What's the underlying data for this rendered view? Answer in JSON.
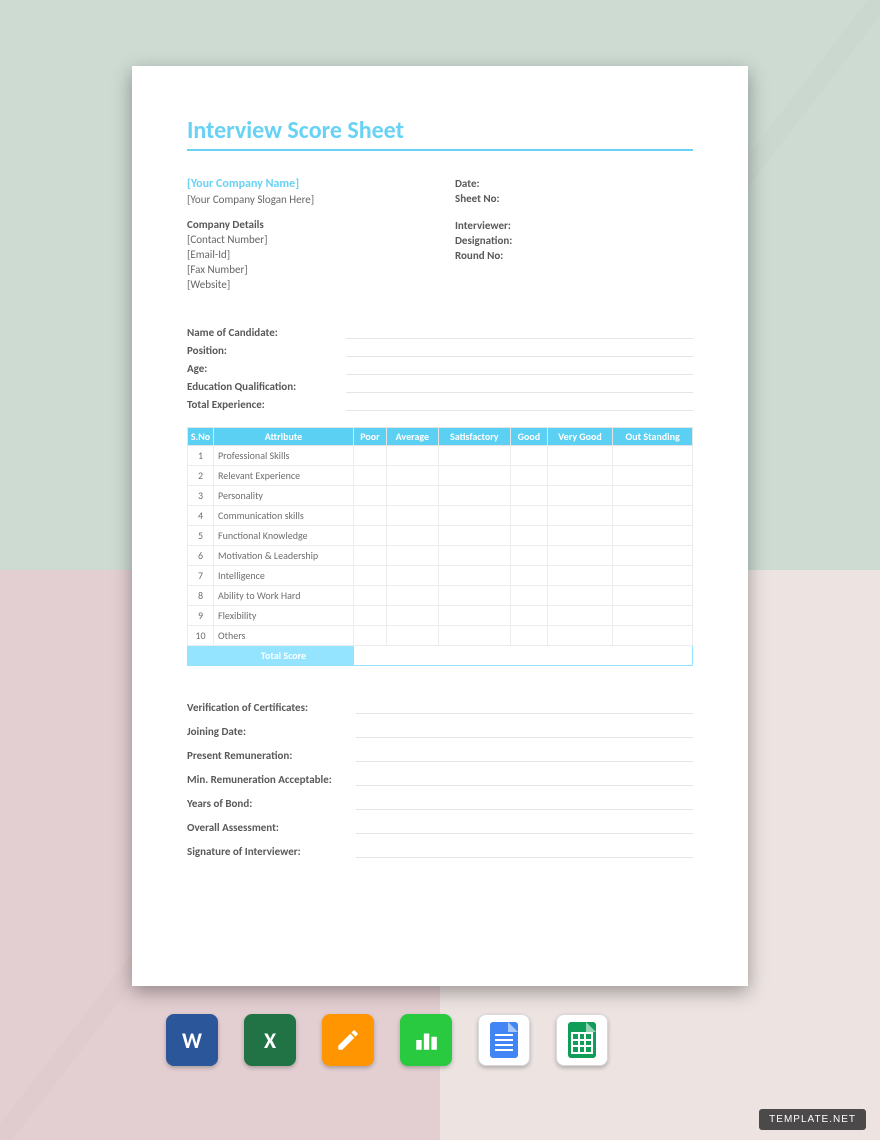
{
  "watermark": "TEMPLATE.NET",
  "document": {
    "title": "Interview Score Sheet",
    "company_name_placeholder": "[Your Company Name]",
    "company_slogan_placeholder": "[Your Company Slogan Here]",
    "meta_right": [
      "Date:",
      "Sheet No:"
    ],
    "company_details_heading": "Company Details",
    "company_details": [
      "[Contact Number]",
      "[Email-Id]",
      "[Fax Number]",
      "[Website]"
    ],
    "interviewer_fields": [
      "Interviewer:",
      "Designation:",
      "Round No:"
    ],
    "candidate_fields": [
      "Name of Candidate:",
      "Position:",
      "Age:",
      "Education Qualification:",
      "Total Experience:"
    ],
    "score_table": {
      "headers": [
        "S.No",
        "Attribute",
        "Poor",
        "Average",
        "Satisfactory",
        "Good",
        "Very Good",
        "Out Standing"
      ],
      "rows": [
        {
          "sn": "1",
          "attr": "Professional Skills"
        },
        {
          "sn": "2",
          "attr": "Relevant Experience"
        },
        {
          "sn": "3",
          "attr": "Personality"
        },
        {
          "sn": "4",
          "attr": "Communication skills"
        },
        {
          "sn": "5",
          "attr": "Functional Knowledge"
        },
        {
          "sn": "6",
          "attr": "Motivation & Leadership"
        },
        {
          "sn": "7",
          "attr": "Intelligence"
        },
        {
          "sn": "8",
          "attr": "Ability to Work Hard"
        },
        {
          "sn": "9",
          "attr": "Flexibility"
        },
        {
          "sn": "10",
          "attr": "Others"
        }
      ],
      "total_label": "Total Score"
    },
    "bottom_fields": [
      "Verification of Certificates:",
      "Joining Date:",
      "Present Remuneration:",
      "Min. Remuneration Acceptable:",
      "Years of Bond:",
      "Overall Assessment:",
      "Signature of Interviewer:"
    ]
  },
  "app_icons": [
    {
      "name": "word-icon",
      "label": "W"
    },
    {
      "name": "excel-icon",
      "label": "X"
    },
    {
      "name": "pages-icon",
      "label": ""
    },
    {
      "name": "numbers-icon",
      "label": ""
    },
    {
      "name": "google-docs-icon",
      "label": ""
    },
    {
      "name": "google-sheets-icon",
      "label": ""
    }
  ]
}
